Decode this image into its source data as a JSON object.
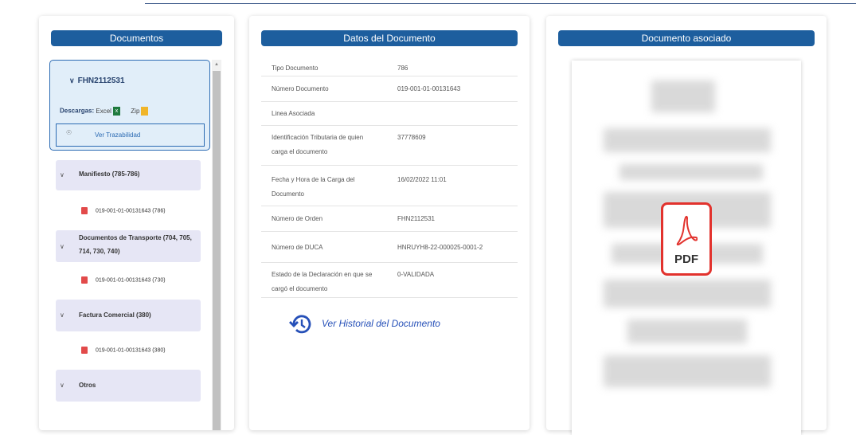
{
  "left": {
    "header": "Documentos",
    "doc_number": "FHN2112531",
    "descargas_label": "Descargas:",
    "excel_label": "Excel",
    "zip_label": "Zip",
    "trace_label": "Ver Trazabilidad",
    "groups": [
      {
        "label": "Manifiesto (785-786)",
        "item": "019-001-01-00131643 (786)"
      },
      {
        "label": "Documentos de Transporte (704, 705,",
        "label2": "714, 730, 740)",
        "item": "019-001-01-00131643 (730)"
      },
      {
        "label": "Factura Comercial (380)",
        "item": "019-001-01-00131643 (380)"
      },
      {
        "label": "Otros"
      }
    ]
  },
  "middle": {
    "header": "Datos del Documento",
    "rows": [
      {
        "key": "Tipo Documento",
        "value": "786"
      },
      {
        "key": "Número Documento",
        "value": "019-001-01-00131643"
      },
      {
        "key": "Linea Asociada",
        "value": ""
      },
      {
        "key": "Identificación Tributaria de quien",
        "key2": "carga el documento",
        "value": "37778609"
      },
      {
        "key": "Fecha y Hora de la Carga del",
        "key2": "Documento",
        "value": "16/02/2022 11:01"
      },
      {
        "key": "Número de Orden",
        "value": "FHN2112531"
      },
      {
        "key": "Número de DUCA",
        "value": "HNRUYH8-22-000025-0001-2"
      },
      {
        "key": "Estado de la Declaración en que se",
        "key2": "cargó el documento",
        "value": "0-VALIDADA"
      }
    ],
    "history_label": "Ver Historial del Documento"
  },
  "right": {
    "header": "Documento asociado",
    "pdf_label": "PDF"
  },
  "colors": {
    "header": "#1d5e9e",
    "accent": "#2650b8",
    "pdf_red": "#e2322d"
  }
}
